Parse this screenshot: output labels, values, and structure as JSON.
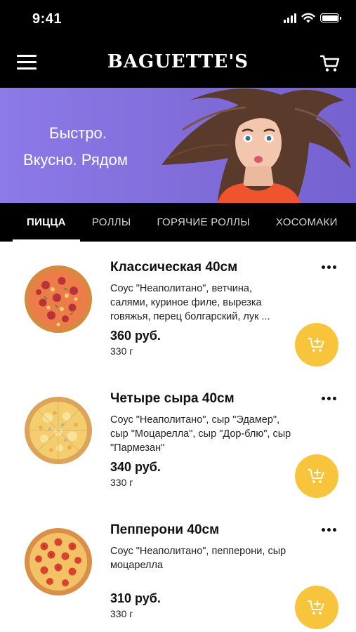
{
  "status_bar": {
    "time": "9:41"
  },
  "header": {
    "brand": "BAGUETTE'S"
  },
  "banner": {
    "line1": "Быстро.",
    "line2": "Вкусно. Рядом"
  },
  "tabs": [
    {
      "label": "ПИЦЦА",
      "active": true
    },
    {
      "label": "РОЛЛЫ",
      "active": false
    },
    {
      "label": "ГОРЯЧИЕ РОЛЛЫ",
      "active": false
    },
    {
      "label": "ХОСОМАКИ",
      "active": false
    }
  ],
  "products": [
    {
      "name": "Классическая 40см",
      "description": "Соус \"Неаполитано\", ветчина, салями, куриное филе, вырезка говяжья, перец болгарский, лук ...",
      "price": "360 руб.",
      "weight": "330 г",
      "image": "pizza-classic"
    },
    {
      "name": "Четыре сыра 40см",
      "description": "Соус \"Неаполитано\", сыр \"Эдамер\", сыр \"Моцарелла\", сыр \"Дор-блю\", сыр \"Пармезан\"",
      "price": "340 руб.",
      "weight": "330 г",
      "image": "pizza-four-cheese"
    },
    {
      "name": "Пепперони 40см",
      "description": "Соус \"Неаполитано\", пепперони, сыр моцарелла",
      "price": "310 руб.",
      "weight": "330 г",
      "image": "pizza-pepperoni"
    }
  ],
  "colors": {
    "header_bg": "#000000",
    "banner_bg": "#8372de",
    "accent": "#f8c43c"
  },
  "icons": {
    "menu": "hamburger-icon",
    "cart": "cart-icon",
    "more": "more-dots-icon",
    "add_to_cart": "cart-plus-icon"
  }
}
